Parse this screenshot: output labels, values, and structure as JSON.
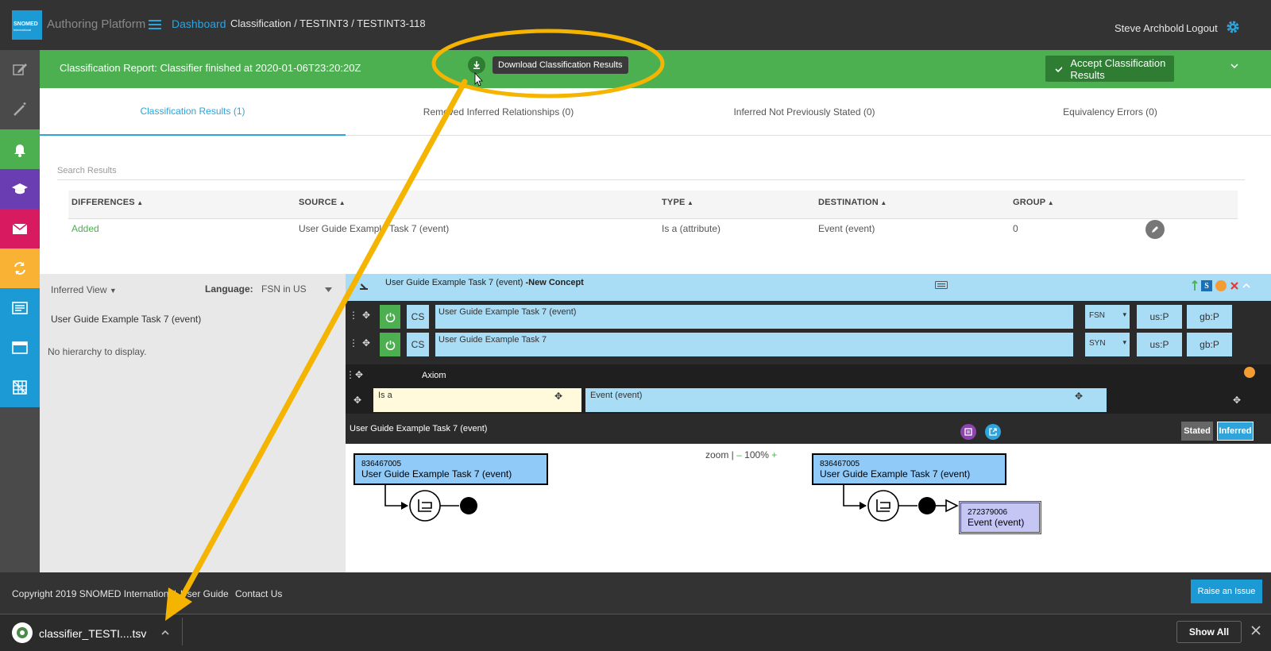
{
  "header": {
    "logo_text": "SNOMED",
    "logo_sub": "International",
    "app_title": "Authoring Platform",
    "breadcrumb_home": "Dashboard",
    "breadcrumbs": "Classification  /  TESTINT3  /  TESTINT3-118",
    "user_name": "Steve Archbold",
    "logout_label": "Logout",
    "menu_icon": "hamburger-menu-icon",
    "settings_icon": "gear-icon"
  },
  "sidebar": {
    "items": [
      {
        "icon": "edit-icon",
        "color": "#4a4a4a"
      },
      {
        "icon": "magic-wand-icon",
        "color": "#4a4a4a"
      },
      {
        "icon": "bell-icon",
        "color": "#4caf50"
      },
      {
        "icon": "graduation-cap-icon",
        "color": "#6a3db3"
      },
      {
        "icon": "envelope-icon",
        "color": "#d81b60"
      },
      {
        "icon": "sync-icon",
        "color": "#f9b233"
      },
      {
        "icon": "list-icon",
        "color": "#1b9ad6"
      },
      {
        "icon": "layout-icon",
        "color": "#1b9ad6"
      },
      {
        "icon": "grid-icon",
        "color": "#1b9ad6"
      }
    ]
  },
  "classification": {
    "report_text": "Classification Report: Classifier finished at 2020-01-06T23:20:20Z",
    "download_tooltip": "Download Classification Results",
    "accept_label": "Accept Classification Results",
    "bar_color": "#4caf50"
  },
  "tabs": [
    {
      "label": "Classification Results (1)",
      "active": true
    },
    {
      "label": "Removed Inferred Relationships (0)",
      "active": false
    },
    {
      "label": "Inferred Not Previously Stated (0)",
      "active": false
    },
    {
      "label": "Equivalency Errors (0)",
      "active": false
    }
  ],
  "results": {
    "search_placeholder": "Search Results",
    "columns": [
      "DIFFERENCES",
      "SOURCE",
      "TYPE",
      "DESTINATION",
      "GROUP"
    ],
    "rows": [
      {
        "difference": "Added",
        "source": "User Guide Example Task 7 (event)",
        "type": "Is a (attribute)",
        "destination": "Event (event)",
        "group": "0"
      }
    ]
  },
  "taxonomy": {
    "view_label": "Inferred View",
    "language_label": "Language:",
    "language_value": "FSN in US",
    "concept": "User Guide Example Task 7 (event)",
    "empty_message": "No hierarchy to display.",
    "collapse_glyph": "‹"
  },
  "concept_editor": {
    "title": "User Guide Example Task 7 (event)",
    "title_suffix": "-New Concept",
    "s_badge": "S",
    "descriptions": [
      {
        "cs": "CS",
        "term": "User Guide Example Task 7 (event)",
        "type": "FSN",
        "us": "us:P",
        "gb": "gb:P"
      },
      {
        "cs": "CS",
        "term": "User Guide Example Task 7",
        "type": "SYN",
        "us": "us:P",
        "gb": "gb:P"
      }
    ],
    "axiom_label": "Axiom",
    "relationship": {
      "type": "Is a",
      "destination": "Event (event)"
    }
  },
  "diagram": {
    "title": "User Guide Example Task 7 (event)",
    "stated_label": "Stated",
    "inferred_label": "Inferred",
    "zoom_label": "zoom |",
    "zoom_minus": "–",
    "zoom_value": "100%",
    "zoom_plus": "+",
    "left_concept": {
      "id": "836467005",
      "term": "User Guide Example Task 7 (event)"
    },
    "right_concept": {
      "id": "836467005",
      "term": "User Guide Example Task 7 (event)"
    },
    "target_concept": {
      "id": "272379006",
      "term": "Event (event)"
    }
  },
  "footer": {
    "copyright": "Copyright 2019 SNOMED International",
    "user_guide": "User Guide",
    "contact": "Contact Us",
    "raise_issue": "Raise an Issue"
  },
  "download_shelf": {
    "file_name": "classifier_TESTI....tsv",
    "show_all": "Show All"
  },
  "annotation": {
    "color": "#f5b400"
  }
}
